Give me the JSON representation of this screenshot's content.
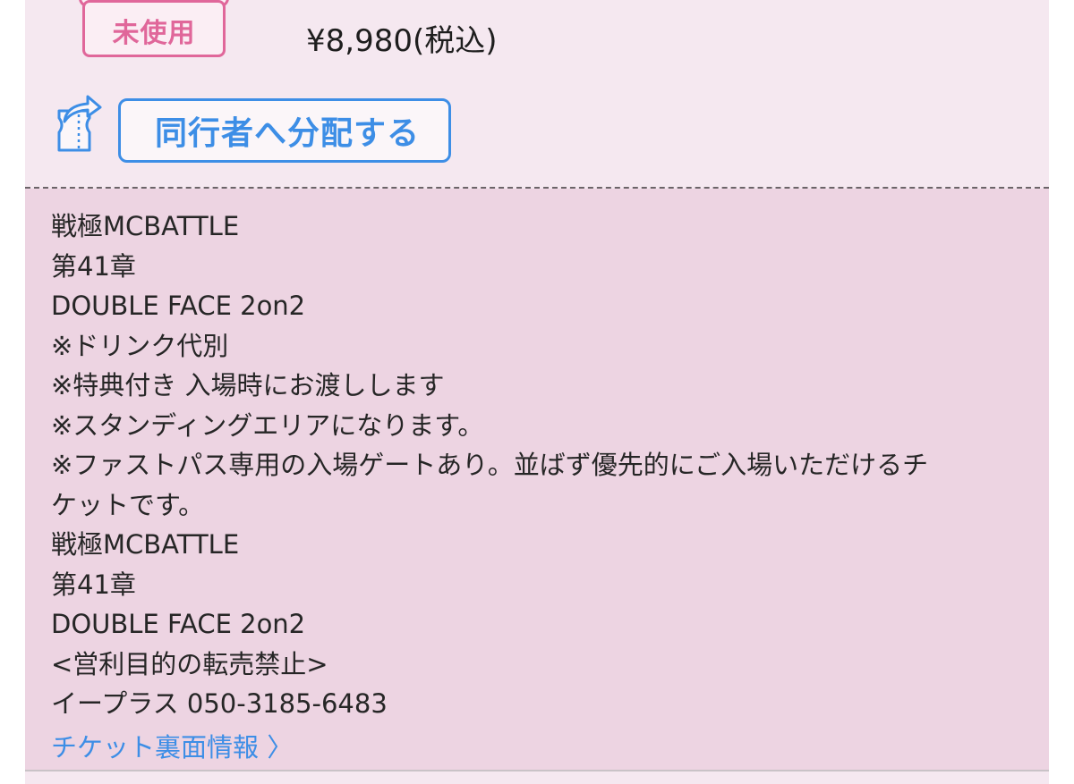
{
  "ticket": {
    "status_badge": "未使用",
    "price": "¥8,980(税込)",
    "distribute_button": "同行者へ分配する"
  },
  "info": {
    "lines": [
      "戦極MCBATTLE",
      "第41章",
      "DOUBLE FACE 2on2",
      "※ドリンク代別",
      "※特典付き 入場時にお渡しします",
      "※スタンディングエリアになります。",
      "※ファストパス専用の入場ゲートあり。並ばず優先的にご入場いただけるチ",
      "ケットです。",
      "戦極MCBATTLE",
      "第41章",
      "DOUBLE FACE 2on2",
      "<営利目的の転売禁止>",
      "イープラス 050-3185-6483"
    ],
    "backside_link": "チケット裏面情報 〉"
  },
  "colors": {
    "accent_blue": "#3d8ee6",
    "badge_pink": "#e0679a",
    "card_bg": "#f5e8f0",
    "info_bg": "#edd4e2"
  },
  "icons": {
    "distribute": "ticket-share-icon",
    "link_arrow": "chevron-right-icon"
  }
}
